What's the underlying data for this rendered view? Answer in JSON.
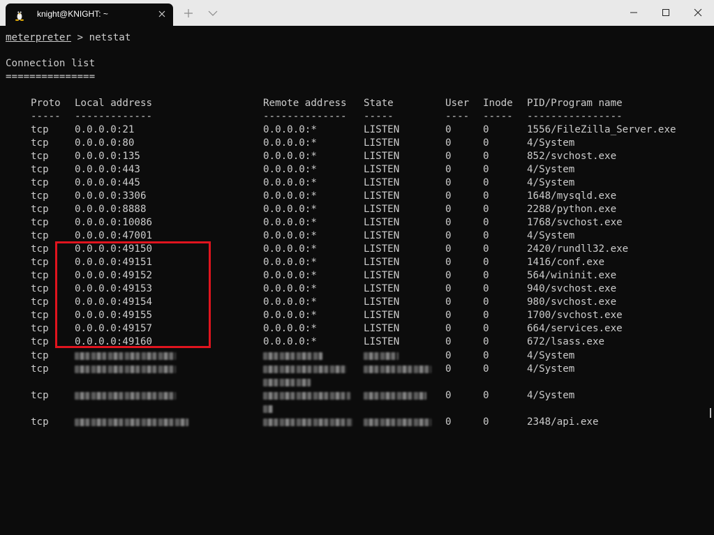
{
  "window": {
    "tab_title": "knight@KNIGHT: ~",
    "icon": "linux-penguin-icon"
  },
  "terminal": {
    "prompt": "meterpreter",
    "command": " > netstat",
    "section_title": "Connection list",
    "title_underline": "===============",
    "headers": {
      "proto": "Proto",
      "local": "Local address",
      "remote": "Remote address",
      "state": "State",
      "user": "User",
      "inode": "Inode",
      "pid": "PID/Program name"
    },
    "header_underlines": {
      "proto": "-----",
      "local": "-------------",
      "remote": "--------------",
      "state": "-----",
      "user": "----",
      "inode": "-----",
      "pid": "----------------"
    },
    "rows": [
      {
        "proto": "tcp",
        "local": "0.0.0.0:21",
        "remote": "0.0.0.0:*",
        "state": "LISTEN",
        "user": "0",
        "inode": "0",
        "pid": "1556/FileZilla_Server.exe"
      },
      {
        "proto": "tcp",
        "local": "0.0.0.0:80",
        "remote": "0.0.0.0:*",
        "state": "LISTEN",
        "user": "0",
        "inode": "0",
        "pid": "4/System"
      },
      {
        "proto": "tcp",
        "local": "0.0.0.0:135",
        "remote": "0.0.0.0:*",
        "state": "LISTEN",
        "user": "0",
        "inode": "0",
        "pid": "852/svchost.exe"
      },
      {
        "proto": "tcp",
        "local": "0.0.0.0:443",
        "remote": "0.0.0.0:*",
        "state": "LISTEN",
        "user": "0",
        "inode": "0",
        "pid": "4/System"
      },
      {
        "proto": "tcp",
        "local": "0.0.0.0:445",
        "remote": "0.0.0.0:*",
        "state": "LISTEN",
        "user": "0",
        "inode": "0",
        "pid": "4/System"
      },
      {
        "proto": "tcp",
        "local": "0.0.0.0:3306",
        "remote": "0.0.0.0:*",
        "state": "LISTEN",
        "user": "0",
        "inode": "0",
        "pid": "1648/mysqld.exe"
      },
      {
        "proto": "tcp",
        "local": "0.0.0.0:8888",
        "remote": "0.0.0.0:*",
        "state": "LISTEN",
        "user": "0",
        "inode": "0",
        "pid": "2288/python.exe"
      },
      {
        "proto": "tcp",
        "local": "0.0.0.0:10086",
        "remote": "0.0.0.0:*",
        "state": "LISTEN",
        "user": "0",
        "inode": "0",
        "pid": "1768/svchost.exe"
      },
      {
        "proto": "tcp",
        "local": "0.0.0.0:47001",
        "remote": "0.0.0.0:*",
        "state": "LISTEN",
        "user": "0",
        "inode": "0",
        "pid": "4/System"
      },
      {
        "proto": "tcp",
        "local": "0.0.0.0:49150",
        "remote": "0.0.0.0:*",
        "state": "LISTEN",
        "user": "0",
        "inode": "0",
        "pid": "2420/rundll32.exe"
      },
      {
        "proto": "tcp",
        "local": "0.0.0.0:49151",
        "remote": "0.0.0.0:*",
        "state": "LISTEN",
        "user": "0",
        "inode": "0",
        "pid": "1416/conf.exe"
      },
      {
        "proto": "tcp",
        "local": "0.0.0.0:49152",
        "remote": "0.0.0.0:*",
        "state": "LISTEN",
        "user": "0",
        "inode": "0",
        "pid": "564/wininit.exe"
      },
      {
        "proto": "tcp",
        "local": "0.0.0.0:49153",
        "remote": "0.0.0.0:*",
        "state": "LISTEN",
        "user": "0",
        "inode": "0",
        "pid": "940/svchost.exe"
      },
      {
        "proto": "tcp",
        "local": "0.0.0.0:49154",
        "remote": "0.0.0.0:*",
        "state": "LISTEN",
        "user": "0",
        "inode": "0",
        "pid": "980/svchost.exe"
      },
      {
        "proto": "tcp",
        "local": "0.0.0.0:49155",
        "remote": "0.0.0.0:*",
        "state": "LISTEN",
        "user": "0",
        "inode": "0",
        "pid": "1700/svchost.exe"
      },
      {
        "proto": "tcp",
        "local": "0.0.0.0:49157",
        "remote": "0.0.0.0:*",
        "state": "LISTEN",
        "user": "0",
        "inode": "0",
        "pid": "664/services.exe"
      },
      {
        "proto": "tcp",
        "local": "0.0.0.0:49160",
        "remote": "0.0.0.0:*",
        "state": "LISTEN",
        "user": "0",
        "inode": "0",
        "pid": "672/lsass.exe"
      }
    ],
    "redacted_rows": [
      {
        "proto": "tcp",
        "user": "0",
        "inode": "0",
        "pid": "4/System"
      },
      {
        "proto": "tcp",
        "user": "0",
        "inode": "0",
        "pid": "4/System"
      },
      {
        "proto": "tcp",
        "user": "0",
        "inode": "0",
        "pid": "4/System"
      },
      {
        "proto": "tcp",
        "user": "0",
        "inode": "0",
        "pid": "2348/api.exe"
      }
    ]
  },
  "colors": {
    "terminal_bg": "#0c0c0c",
    "terminal_fg": "#cccccc",
    "titlebar_bg": "#e9e9e9",
    "highlight": "#e0141e"
  }
}
